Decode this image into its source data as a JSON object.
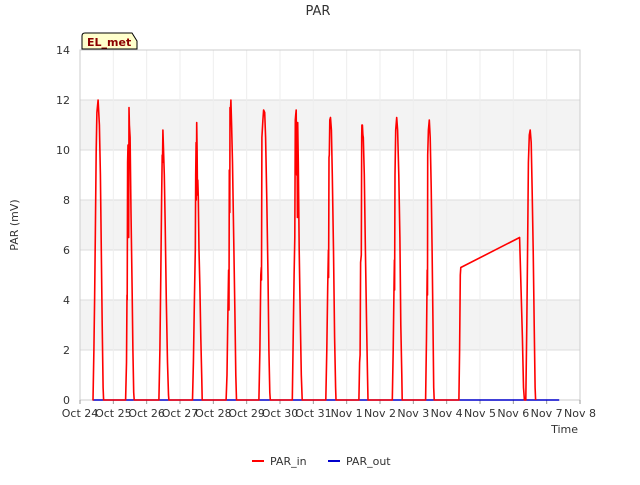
{
  "chart_data": {
    "type": "line",
    "title": "PAR",
    "xlabel": "Time",
    "ylabel": "PAR (mV)",
    "badge": "EL_met",
    "ylim": [
      0,
      14
    ],
    "y_ticks": [
      0,
      2,
      4,
      6,
      8,
      10,
      12,
      14
    ],
    "xlim": [
      "2023-10-24",
      "2023-11-08"
    ],
    "x_ticks": [
      "Oct 24",
      "Oct 25",
      "Oct 26",
      "Oct 27",
      "Oct 28",
      "Oct 29",
      "Oct 30",
      "Oct 31",
      "Nov 1",
      "Nov 2",
      "Nov 3",
      "Nov 4",
      "Nov 5",
      "Nov 6",
      "Nov 7",
      "Nov 8"
    ],
    "grid": true,
    "band_color": "#f3f3f3",
    "legend_position": "bottom-center",
    "series": [
      {
        "name": "PAR_in",
        "color": "#ff0000",
        "points": [
          [
            "2023-10-24T09:00",
            0
          ],
          [
            "2023-10-24T09:20",
            0
          ],
          [
            "2023-10-24T10:00",
            2.0
          ],
          [
            "2023-10-24T10:30",
            4.0
          ],
          [
            "2023-10-24T11:00",
            6.5
          ],
          [
            "2023-10-24T11:40",
            10.0
          ],
          [
            "2023-10-24T12:10",
            11.5
          ],
          [
            "2023-10-24T13:00",
            12.0
          ],
          [
            "2023-10-24T14:00",
            11.0
          ],
          [
            "2023-10-24T14:40",
            9.0
          ],
          [
            "2023-10-24T15:20",
            6.0
          ],
          [
            "2023-10-24T16:00",
            3.0
          ],
          [
            "2023-10-24T16:40",
            0.5
          ],
          [
            "2023-10-24T17:00",
            0
          ],
          [
            "2023-10-25T08:50",
            0
          ],
          [
            "2023-10-25T09:30",
            1.5
          ],
          [
            "2023-10-25T09:50",
            4.2
          ],
          [
            "2023-10-25T10:00",
            4.0
          ],
          [
            "2023-10-25T10:15",
            9.5
          ],
          [
            "2023-10-25T10:35",
            10.2
          ],
          [
            "2023-10-25T10:55",
            10.1
          ],
          [
            "2023-10-25T11:05",
            6.5
          ],
          [
            "2023-10-25T11:15",
            11.7
          ],
          [
            "2023-10-25T11:35",
            11.0
          ],
          [
            "2023-10-25T12:05",
            10.5
          ],
          [
            "2023-10-25T12:45",
            7.5
          ],
          [
            "2023-10-25T13:30",
            4.5
          ],
          [
            "2023-10-25T14:05",
            2.0
          ],
          [
            "2023-10-25T14:40",
            0.3
          ],
          [
            "2023-10-25T15:00",
            0
          ],
          [
            "2023-10-26T08:50",
            0
          ],
          [
            "2023-10-26T09:30",
            2.0
          ],
          [
            "2023-10-26T10:10",
            5.0
          ],
          [
            "2023-10-26T10:45",
            8.0
          ],
          [
            "2023-10-26T11:10",
            9.8
          ],
          [
            "2023-10-26T11:25",
            9.5
          ],
          [
            "2023-10-26T11:40",
            10.8
          ],
          [
            "2023-10-26T12:00",
            10.3
          ],
          [
            "2023-10-26T12:40",
            9.0
          ],
          [
            "2023-10-26T13:20",
            7.0
          ],
          [
            "2023-10-26T14:10",
            4.0
          ],
          [
            "2023-10-26T15:00",
            1.5
          ],
          [
            "2023-10-26T15:45",
            0.2
          ],
          [
            "2023-10-26T16:00",
            0
          ],
          [
            "2023-10-27T09:00",
            0
          ],
          [
            "2023-10-27T09:40",
            1.5
          ],
          [
            "2023-10-27T10:20",
            4.0
          ],
          [
            "2023-10-27T11:00",
            6.0
          ],
          [
            "2023-10-27T11:20",
            9.0
          ],
          [
            "2023-10-27T11:35",
            10.3
          ],
          [
            "2023-10-27T11:45",
            8.0
          ],
          [
            "2023-10-27T12:00",
            11.1
          ],
          [
            "2023-10-27T12:20",
            10.0
          ],
          [
            "2023-10-27T12:35",
            8.2
          ],
          [
            "2023-10-27T12:50",
            8.8
          ],
          [
            "2023-10-27T13:10",
            8.1
          ],
          [
            "2023-10-27T13:40",
            6.0
          ],
          [
            "2023-10-27T14:20",
            4.5
          ],
          [
            "2023-10-27T15:00",
            2.5
          ],
          [
            "2023-10-27T15:40",
            0.8
          ],
          [
            "2023-10-27T16:00",
            0
          ],
          [
            "2023-10-28T09:10",
            0
          ],
          [
            "2023-10-28T09:50",
            1.0
          ],
          [
            "2023-10-28T10:30",
            3.5
          ],
          [
            "2023-10-28T11:00",
            5.2
          ],
          [
            "2023-10-28T11:15",
            3.6
          ],
          [
            "2023-10-28T11:30",
            9.2
          ],
          [
            "2023-10-28T11:50",
            7.5
          ],
          [
            "2023-10-28T12:00",
            11.7
          ],
          [
            "2023-10-28T12:20",
            11.6
          ],
          [
            "2023-10-28T12:40",
            12.0
          ],
          [
            "2023-10-28T13:10",
            11.0
          ],
          [
            "2023-10-28T13:50",
            9.5
          ],
          [
            "2023-10-28T14:40",
            6.5
          ],
          [
            "2023-10-28T15:30",
            3.5
          ],
          [
            "2023-10-28T16:10",
            1.0
          ],
          [
            "2023-10-28T16:40",
            0
          ],
          [
            "2023-10-29T08:50",
            0
          ],
          [
            "2023-10-29T09:30",
            2.0
          ],
          [
            "2023-10-29T10:10",
            5.0
          ],
          [
            "2023-10-29T10:30",
            5.3
          ],
          [
            "2023-10-29T10:40",
            4.8
          ],
          [
            "2023-10-29T11:00",
            10.5
          ],
          [
            "2023-10-29T11:40",
            11.2
          ],
          [
            "2023-10-29T12:10",
            11.6
          ],
          [
            "2023-10-29T13:00",
            11.5
          ],
          [
            "2023-10-29T13:40",
            10.5
          ],
          [
            "2023-10-29T14:30",
            8.0
          ],
          [
            "2023-10-29T15:20",
            5.0
          ],
          [
            "2023-10-29T16:00",
            2.0
          ],
          [
            "2023-10-29T16:40",
            0.3
          ],
          [
            "2023-10-29T17:00",
            0
          ],
          [
            "2023-10-30T08:50",
            0
          ],
          [
            "2023-10-30T09:30",
            2.5
          ],
          [
            "2023-10-30T10:10",
            5.0
          ],
          [
            "2023-10-30T10:40",
            6.5
          ],
          [
            "2023-10-30T11:00",
            11.2
          ],
          [
            "2023-10-30T11:20",
            11.4
          ],
          [
            "2023-10-30T11:40",
            11.6
          ],
          [
            "2023-10-30T12:00",
            9.0
          ],
          [
            "2023-10-30T12:15",
            11.1
          ],
          [
            "2023-10-30T12:30",
            7.3
          ],
          [
            "2023-10-30T12:45",
            11.1
          ],
          [
            "2023-10-30T13:10",
            9.5
          ],
          [
            "2023-10-30T13:50",
            6.0
          ],
          [
            "2023-10-30T14:40",
            3.0
          ],
          [
            "2023-10-30T15:20",
            1.0
          ],
          [
            "2023-10-30T16:00",
            0
          ],
          [
            "2023-10-31T09:00",
            0
          ],
          [
            "2023-10-31T09:40",
            2.0
          ],
          [
            "2023-10-31T10:20",
            4.5
          ],
          [
            "2023-10-31T10:50",
            6.0
          ],
          [
            "2023-10-31T11:00",
            4.9
          ],
          [
            "2023-10-31T11:15",
            9.7
          ],
          [
            "2023-10-31T11:30",
            9.8
          ],
          [
            "2023-10-31T11:50",
            11.2
          ],
          [
            "2023-10-31T12:20",
            11.3
          ],
          [
            "2023-10-31T13:00",
            10.8
          ],
          [
            "2023-10-31T13:40",
            9.0
          ],
          [
            "2023-10-31T14:30",
            6.0
          ],
          [
            "2023-10-31T15:20",
            2.5
          ],
          [
            "2023-10-31T16:00",
            0.5
          ],
          [
            "2023-10-31T16:20",
            0
          ],
          [
            "2023-11-01T08:50",
            0
          ],
          [
            "2023-11-01T09:20",
            1.5
          ],
          [
            "2023-11-01T09:40",
            1.8
          ],
          [
            "2023-11-01T10:00",
            5.5
          ],
          [
            "2023-11-01T10:30",
            5.8
          ],
          [
            "2023-11-01T10:50",
            10.5
          ],
          [
            "2023-11-01T11:00",
            11.0
          ],
          [
            "2023-11-01T11:20",
            11.0
          ],
          [
            "2023-11-01T11:40",
            10.6
          ],
          [
            "2023-11-01T12:00",
            10.5
          ],
          [
            "2023-11-01T12:40",
            9.0
          ],
          [
            "2023-11-01T13:30",
            6.0
          ],
          [
            "2023-11-01T14:20",
            3.0
          ],
          [
            "2023-11-01T15:00",
            1.0
          ],
          [
            "2023-11-01T15:20",
            0
          ],
          [
            "2023-11-02T08:50",
            0
          ],
          [
            "2023-11-02T09:30",
            2.0
          ],
          [
            "2023-11-02T10:10",
            4.8
          ],
          [
            "2023-11-02T10:20",
            5.6
          ],
          [
            "2023-11-02T10:30",
            4.4
          ],
          [
            "2023-11-02T10:50",
            9.0
          ],
          [
            "2023-11-02T11:20",
            10.8
          ],
          [
            "2023-11-02T12:00",
            11.3
          ],
          [
            "2023-11-02T12:40",
            10.8
          ],
          [
            "2023-11-02T13:30",
            9.0
          ],
          [
            "2023-11-02T14:20",
            6.5
          ],
          [
            "2023-11-02T15:00",
            3.0
          ],
          [
            "2023-11-02T15:40",
            1.0
          ],
          [
            "2023-11-02T16:00",
            0
          ],
          [
            "2023-11-03T08:50",
            0
          ],
          [
            "2023-11-03T09:30",
            2.5
          ],
          [
            "2023-11-03T10:00",
            5.2
          ],
          [
            "2023-11-03T10:10",
            4.2
          ],
          [
            "2023-11-03T10:20",
            9.8
          ],
          [
            "2023-11-03T10:50",
            10.8
          ],
          [
            "2023-11-03T11:30",
            11.2
          ],
          [
            "2023-11-03T12:10",
            10.5
          ],
          [
            "2023-11-03T12:50",
            8.5
          ],
          [
            "2023-11-03T13:30",
            6.0
          ],
          [
            "2023-11-03T14:10",
            3.0
          ],
          [
            "2023-11-03T14:40",
            0.5
          ],
          [
            "2023-11-03T15:00",
            0
          ],
          [
            "2023-11-04T08:50",
            0
          ],
          [
            "2023-11-04T09:20",
            2.0
          ],
          [
            "2023-11-04T09:50",
            5.0
          ],
          [
            "2023-11-04T10:10",
            5.3
          ],
          [
            "2023-11-06T04:30",
            6.5
          ],
          [
            "2023-11-06T05:30",
            4.5
          ],
          [
            "2023-11-06T06:30",
            2.5
          ],
          [
            "2023-11-06T07:20",
            0.5
          ],
          [
            "2023-11-06T08:00",
            0
          ],
          [
            "2023-11-06T09:00",
            0
          ],
          [
            "2023-11-06T09:40",
            3.0
          ],
          [
            "2023-11-06T10:20",
            6.5
          ],
          [
            "2023-11-06T10:50",
            9.5
          ],
          [
            "2023-11-06T11:30",
            10.6
          ],
          [
            "2023-11-06T12:10",
            10.8
          ],
          [
            "2023-11-06T12:50",
            10.3
          ],
          [
            "2023-11-06T13:30",
            8.5
          ],
          [
            "2023-11-06T14:20",
            6.0
          ],
          [
            "2023-11-06T15:00",
            3.0
          ],
          [
            "2023-11-06T15:40",
            0.5
          ],
          [
            "2023-11-06T16:00",
            0
          ]
        ]
      },
      {
        "name": "PAR_out",
        "color": "#0000cc",
        "points": [
          [
            "2023-10-24T09:00",
            0
          ],
          [
            "2023-11-07T09:00",
            0
          ]
        ]
      }
    ]
  }
}
